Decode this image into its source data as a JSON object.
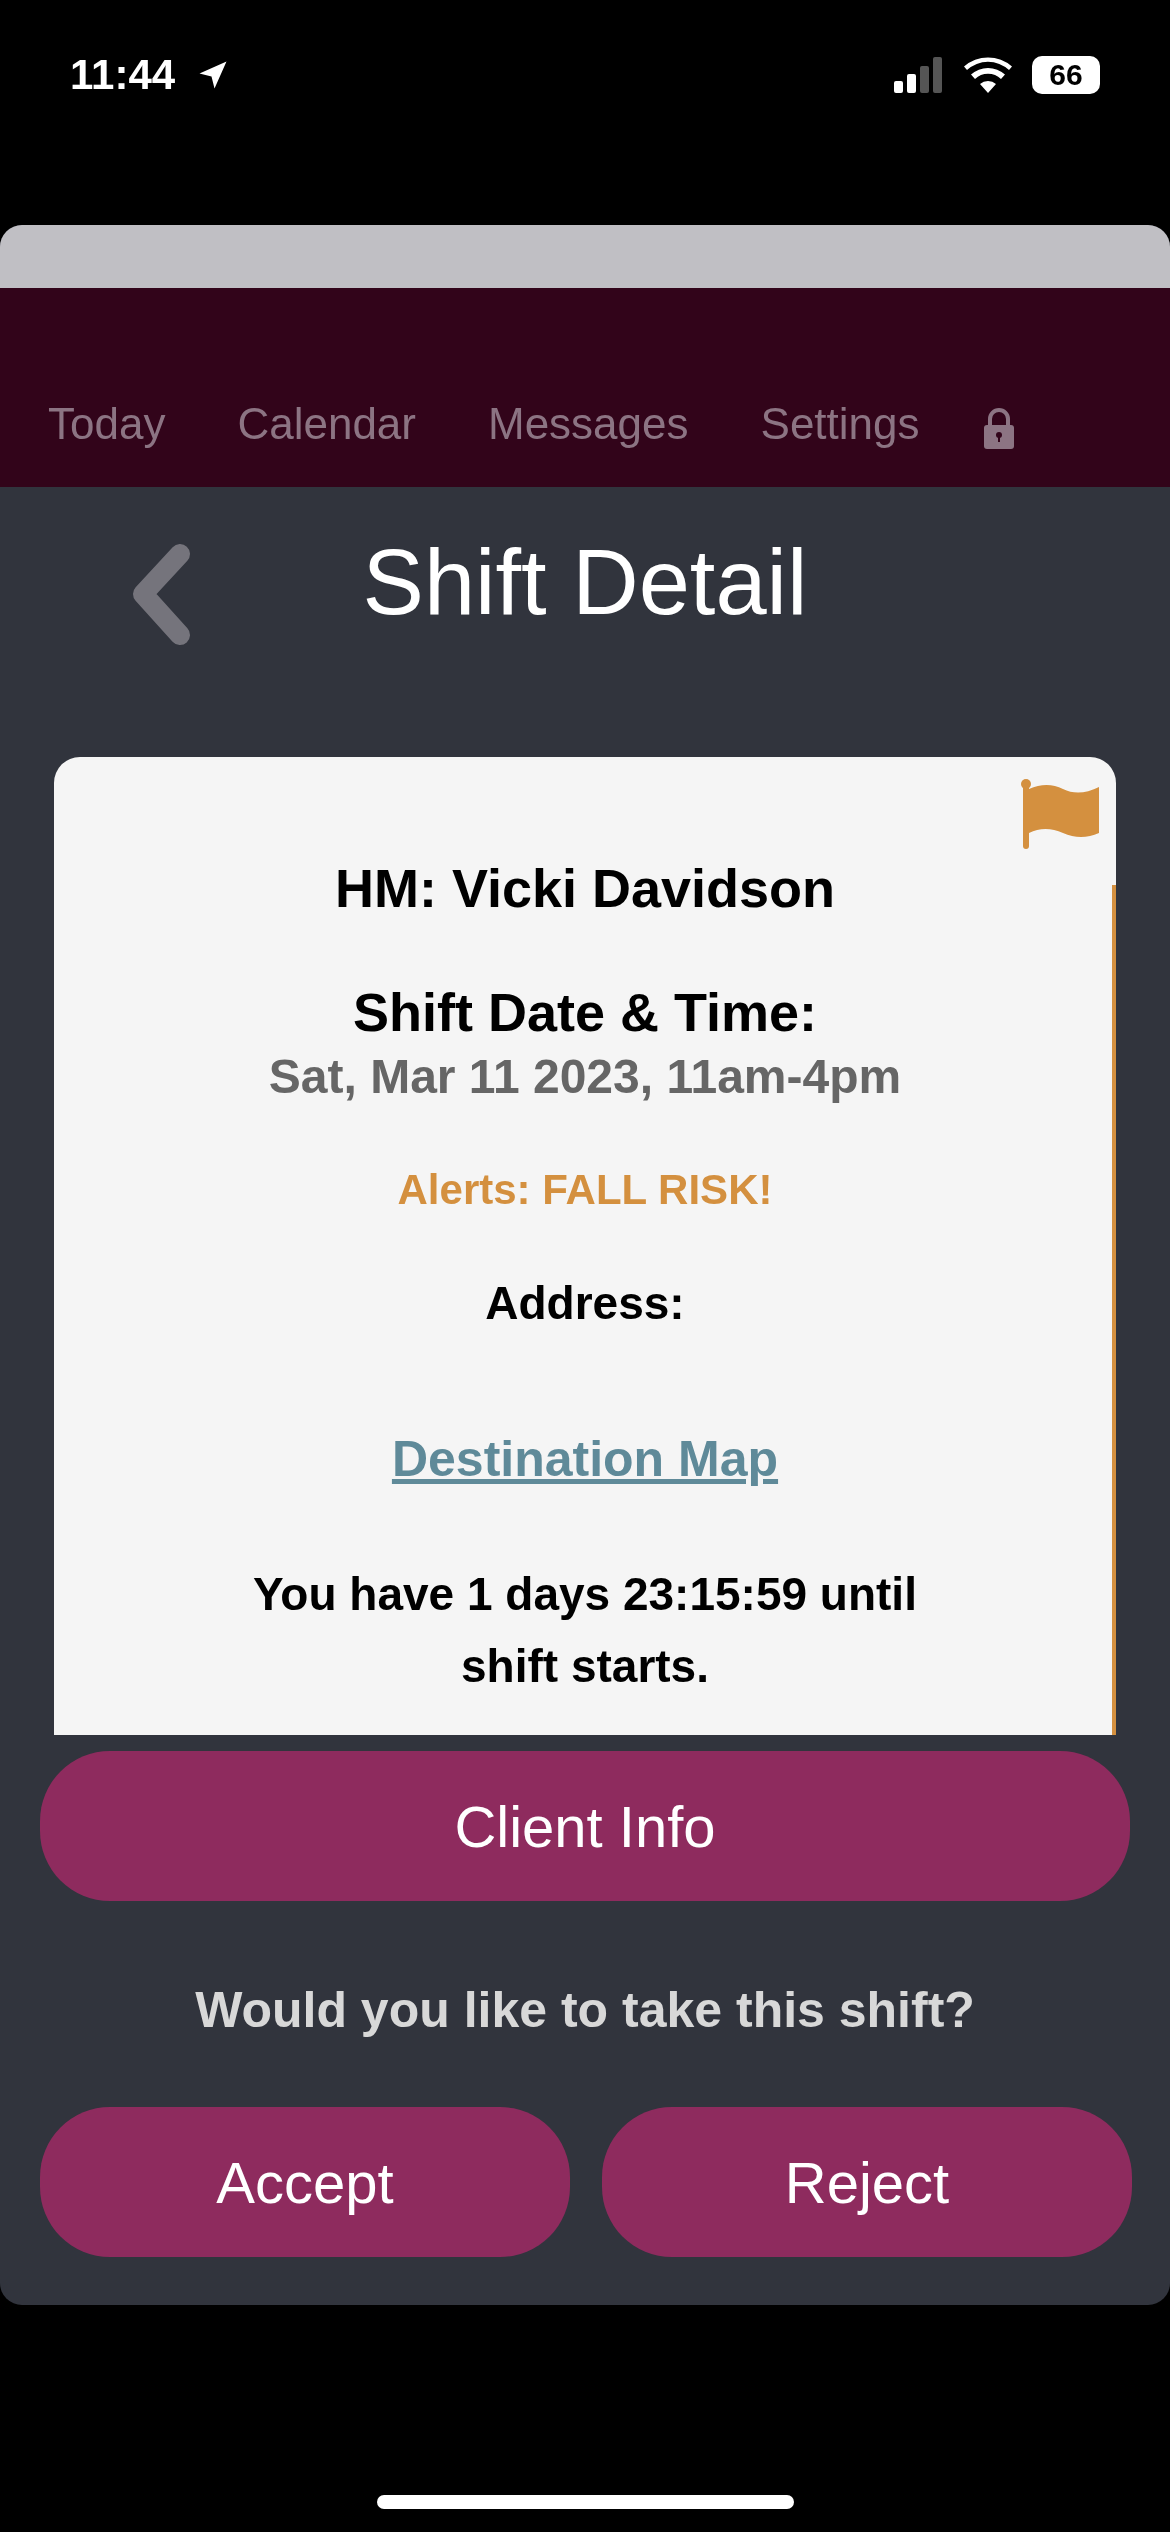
{
  "status_bar": {
    "time": "11:44",
    "battery": "66"
  },
  "nav": {
    "items": [
      {
        "label": "Today",
        "selected": false
      },
      {
        "label": "Calendar",
        "selected": false
      },
      {
        "label": "Messages",
        "selected": false
      },
      {
        "label": "Settings",
        "selected": false
      }
    ]
  },
  "header": {
    "title": "Shift Detail"
  },
  "card": {
    "flagged": true,
    "home_manager": "HM: Vicki Davidson",
    "date_label": "Shift Date & Time:",
    "date_value": "Sat, Mar 11 2023, 11am-4pm",
    "alerts": "Alerts: FALL RISK!",
    "address_label": "Address:",
    "map_link": "Destination Map",
    "countdown": "You have 1 days 23:15:59 until shift starts."
  },
  "client_info_button": "Client Info",
  "question": "Would you like to take this shift?",
  "buttons": [
    "Accept",
    "Reject"
  ]
}
